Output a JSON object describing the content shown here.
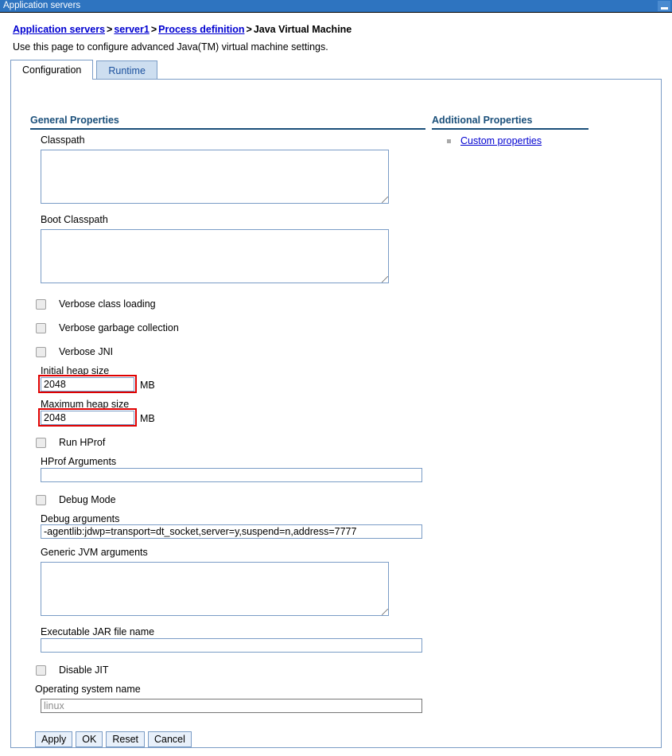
{
  "window": {
    "title": "Application servers",
    "minimize_icon": "minimize-icon"
  },
  "breadcrumb": {
    "items": [
      {
        "label": "Application servers",
        "link": true
      },
      {
        "label": "server1",
        "link": true
      },
      {
        "label": "Process definition",
        "link": true
      },
      {
        "label": "Java Virtual Machine",
        "link": false
      }
    ],
    "separator": ">"
  },
  "page": {
    "description": "Use this page to configure advanced Java(TM) virtual machine settings."
  },
  "tabs": [
    {
      "label": "Configuration",
      "active": true
    },
    {
      "label": "Runtime",
      "active": false
    }
  ],
  "sections": {
    "general": {
      "title": "General Properties"
    },
    "additional": {
      "title": "Additional Properties",
      "links": [
        {
          "label": "Custom properties",
          "bullet": "square-bullet"
        }
      ]
    }
  },
  "fields": {
    "classpath": {
      "label": "Classpath",
      "value": ""
    },
    "boot_classpath": {
      "label": "Boot Classpath",
      "value": ""
    },
    "verbose_class_loading": {
      "label": "Verbose class loading",
      "checked": false
    },
    "verbose_gc": {
      "label": "Verbose garbage collection",
      "checked": false
    },
    "verbose_jni": {
      "label": "Verbose JNI",
      "checked": false
    },
    "initial_heap": {
      "label": "Initial heap size",
      "value": "2048",
      "unit": "MB",
      "highlighted": true
    },
    "maximum_heap": {
      "label": "Maximum heap size",
      "value": "2048",
      "unit": "MB",
      "highlighted": true
    },
    "run_hprof": {
      "label": "Run HProf",
      "checked": false
    },
    "hprof_args": {
      "label": "HProf Arguments",
      "value": ""
    },
    "debug_mode": {
      "label": "Debug Mode",
      "checked": false
    },
    "debug_args": {
      "label": "Debug arguments",
      "value": "-agentlib:jdwp=transport=dt_socket,server=y,suspend=n,address=7777"
    },
    "generic_jvm_args": {
      "label": "Generic JVM arguments",
      "value": ""
    },
    "executable_jar": {
      "label": "Executable JAR file name",
      "value": ""
    },
    "disable_jit": {
      "label": "Disable JIT",
      "checked": false
    },
    "os_name": {
      "label": "Operating system name",
      "value": "linux",
      "readonly": true
    }
  },
  "buttons": [
    {
      "label": "Apply"
    },
    {
      "label": "OK"
    },
    {
      "label": "Reset"
    },
    {
      "label": "Cancel"
    }
  ],
  "colors": {
    "titlebar": "#2e74c0",
    "link": "#0000d0",
    "section_heading": "#1a4f7a",
    "highlight": "#e00000",
    "tab_inactive_bg": "#cddef0",
    "field_border": "#7a9cc6"
  }
}
